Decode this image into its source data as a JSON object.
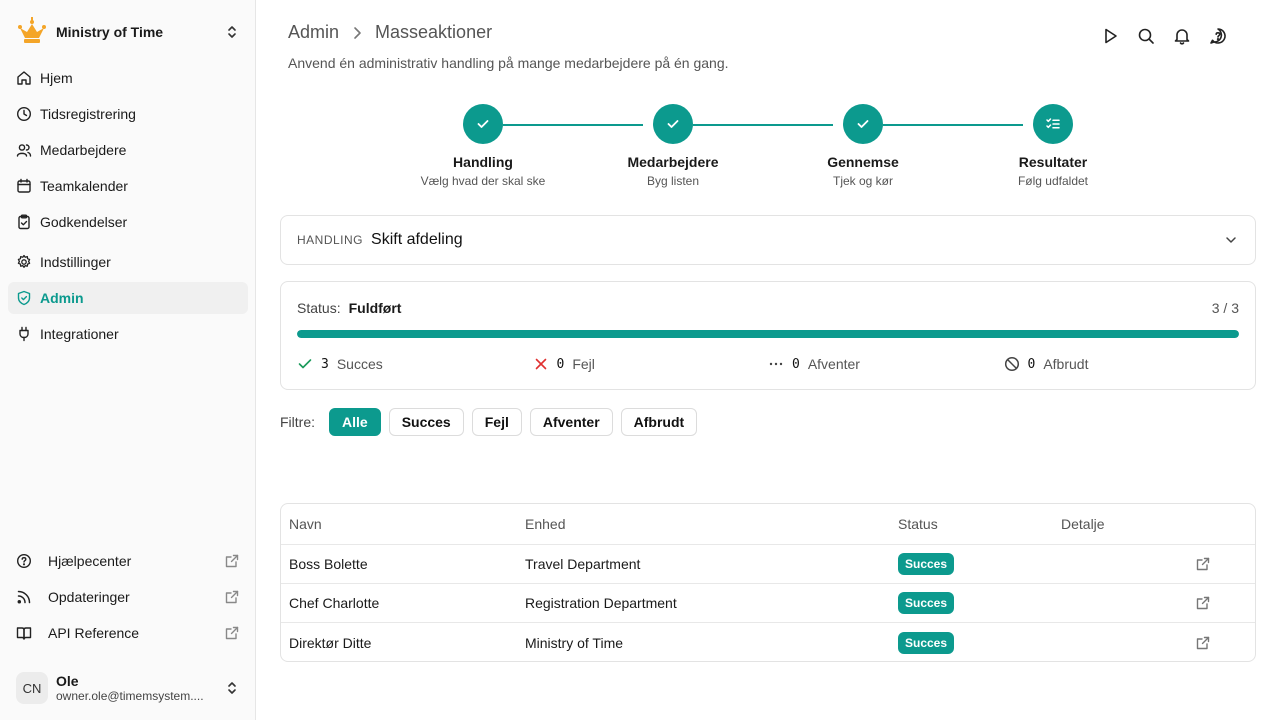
{
  "sidebar": {
    "org_name": "Ministry of Time",
    "nav": [
      {
        "label": "Hjem",
        "icon": "home-icon"
      },
      {
        "label": "Tidsregistrering",
        "icon": "clock-icon"
      },
      {
        "label": "Medarbejdere",
        "icon": "users-icon"
      },
      {
        "label": "Teamkalender",
        "icon": "calendar-icon"
      },
      {
        "label": "Godkendelser",
        "icon": "clipboard-check-icon"
      },
      {
        "label": "Indstillinger",
        "icon": "gear-icon"
      },
      {
        "label": "Admin",
        "icon": "shield-check-icon",
        "active": true
      },
      {
        "label": "Integrationer",
        "icon": "plug-icon"
      }
    ],
    "footer_links": [
      {
        "label": "Hjælpecenter",
        "icon": "help-circle-icon"
      },
      {
        "label": "Opdateringer",
        "icon": "rss-icon"
      },
      {
        "label": "API Reference",
        "icon": "book-icon"
      }
    ],
    "user": {
      "initials": "CN",
      "name": "Ole",
      "email": "owner.ole@timemsystem...."
    }
  },
  "header": {
    "breadcrumb": [
      "Admin",
      "Masseaktioner"
    ],
    "subtitle": "Anvend én administrativ handling på mange medarbejdere på én gang.",
    "icons": [
      "play-icon",
      "search-icon",
      "bell-icon",
      "message-help-icon"
    ]
  },
  "stepper": [
    {
      "title": "Handling",
      "desc": "Vælg hvad der skal ske",
      "state": "done"
    },
    {
      "title": "Medarbejdere",
      "desc": "Byg listen",
      "state": "done"
    },
    {
      "title": "Gennemse",
      "desc": "Tjek og kør",
      "state": "done"
    },
    {
      "title": "Resultater",
      "desc": "Følg udfaldet",
      "state": "current"
    }
  ],
  "action": {
    "label": "HANDLING",
    "value": "Skift afdeling"
  },
  "status": {
    "label": "Status:",
    "value": "Fuldført",
    "count": "3 / 3",
    "progress_percent": 100,
    "counts": [
      {
        "num": "3",
        "label": "Succes",
        "icon": "check-icon",
        "color": "#1a9a5a"
      },
      {
        "num": "0",
        "label": "Fejl",
        "icon": "x-icon",
        "color": "#e03030"
      },
      {
        "num": "0",
        "label": "Afventer",
        "icon": "dots-icon",
        "color": "#444444"
      },
      {
        "num": "0",
        "label": "Afbrudt",
        "icon": "ban-icon",
        "color": "#444444"
      }
    ]
  },
  "filters": {
    "label": "Filtre:",
    "chips": [
      "Alle",
      "Succes",
      "Fejl",
      "Afventer",
      "Afbrudt"
    ],
    "active": "Alle"
  },
  "table": {
    "headers": [
      "Navn",
      "Enhed",
      "Status",
      "Detalje"
    ],
    "rows": [
      {
        "name": "Boss Bolette",
        "unit": "Travel Department",
        "status": "Succes"
      },
      {
        "name": "Chef Charlotte",
        "unit": "Registration Department",
        "status": "Succes"
      },
      {
        "name": "Direktør Ditte",
        "unit": "Ministry of Time",
        "status": "Succes"
      }
    ]
  },
  "colors": {
    "accent": "#0c9a8e"
  }
}
